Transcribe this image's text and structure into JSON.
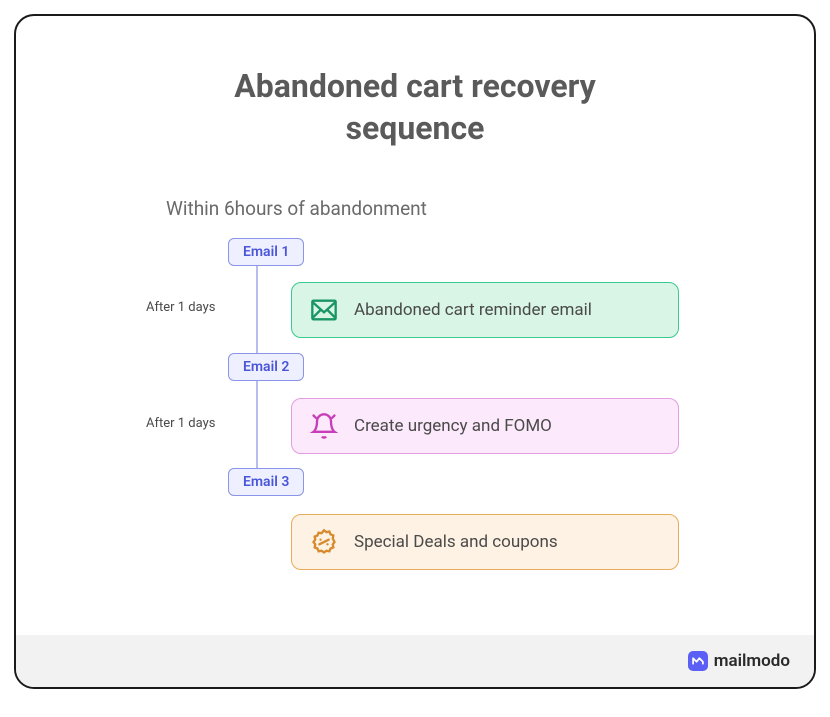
{
  "title_line1": "Abandoned cart recovery",
  "title_line2": "sequence",
  "subtitle": "Within 6hours of abandonment",
  "emails": {
    "e1": "Email 1",
    "e2": "Email 2",
    "e3": "Email 3"
  },
  "timings": {
    "t1": "After 1 days",
    "t2": "After 1 days"
  },
  "steps": {
    "s1": "Abandoned cart reminder email",
    "s2": "Create urgency and FOMO",
    "s3": "Special Deals and coupons"
  },
  "brand": "mailmodo"
}
